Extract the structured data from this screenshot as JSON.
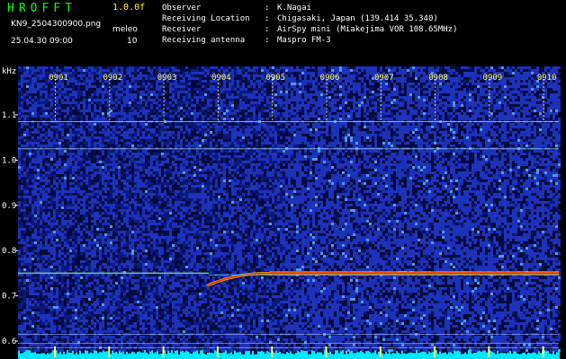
{
  "app": {
    "title": "HROFFT",
    "version": "1.0.0f"
  },
  "file": {
    "name": "KN9_2504300900.png",
    "datetime": "25.04.30 09:00"
  },
  "meta": {
    "label": "meleo",
    "value": "10"
  },
  "info": [
    {
      "key": "Observer",
      "value": "K.Nagai"
    },
    {
      "key": "Receiving Location",
      "value": "Chigasaki, Japan (139.414 35.340)"
    },
    {
      "key": "Receiver",
      "value": "AirSpy mini (Miakejima VOR 108.65MHz)"
    },
    {
      "key": "Receiving antenna",
      "value": "Maspro FM-3"
    }
  ],
  "colors": {
    "background": "#000000",
    "noise_dark": "#000a3c",
    "noise_mid": "#1f36c8",
    "noise_bright": "#58a8ff",
    "signal_hot": "#ff2200",
    "signal_warm": "#ffcc00",
    "baseline": "#00e8ff",
    "title": "#00ff00",
    "ticks": "#ffff66"
  },
  "chart_data": {
    "type": "heatmap",
    "ylabel": "kHz",
    "y_ticks": [
      "1.1",
      "1.0",
      "0.9",
      "0.8",
      "0.7",
      "0.6"
    ],
    "x_ticks": [
      "0901",
      "0902",
      "0903",
      "0904",
      "0905",
      "0906",
      "0907",
      "0908",
      "0909",
      "0910"
    ],
    "carrier_freq_khz": 0.75,
    "interference_lines_khz": [
      1.085,
      1.025
    ]
  }
}
